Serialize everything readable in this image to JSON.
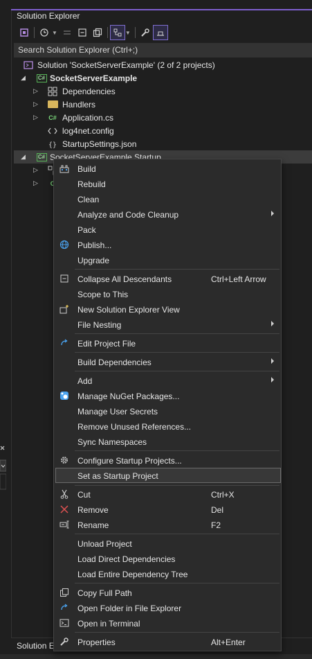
{
  "panel": {
    "title": "Solution Explorer"
  },
  "toolbar": {
    "buttons": [
      "vs-solution-icon",
      "history-icon",
      "sync-icon",
      "collapse-icon",
      "pages-icon",
      "view-icon",
      "wrench-icon",
      "preview-icon"
    ]
  },
  "search": {
    "placeholder": "Search Solution Explorer (Ctrl+;)"
  },
  "tree": {
    "solution": "Solution 'SocketServerExample' (2 of 2 projects)",
    "project1": "SocketServerExample",
    "dependencies": "Dependencies",
    "handlers": "Handlers",
    "application": "Application.cs",
    "log4net": "log4net.config",
    "startup_settings": "StartupSettings.json",
    "project2": "SocketServerExample.Startup"
  },
  "bottom_tab": {
    "label": "Solution E"
  },
  "context_menu": {
    "build": "Build",
    "rebuild": "Rebuild",
    "clean": "Clean",
    "analyze": "Analyze and Code Cleanup",
    "pack": "Pack",
    "publish": "Publish...",
    "upgrade": "Upgrade",
    "collapse_all": "Collapse All Descendants",
    "collapse_all_sc": "Ctrl+Left Arrow",
    "scope": "Scope to This",
    "new_view": "New Solution Explorer View",
    "file_nesting": "File Nesting",
    "edit_project": "Edit Project File",
    "build_deps": "Build Dependencies",
    "add": "Add",
    "nuget": "Manage NuGet Packages...",
    "user_secrets": "Manage User Secrets",
    "remove_unused": "Remove Unused References...",
    "sync_ns": "Sync Namespaces",
    "configure_startup": "Configure Startup Projects...",
    "set_startup": "Set as Startup Project",
    "cut": "Cut",
    "cut_sc": "Ctrl+X",
    "remove": "Remove",
    "remove_sc": "Del",
    "rename": "Rename",
    "rename_sc": "F2",
    "unload": "Unload Project",
    "load_direct": "Load Direct Dependencies",
    "load_entire": "Load Entire Dependency Tree",
    "copy_path": "Copy Full Path",
    "open_folder": "Open Folder in File Explorer",
    "open_terminal": "Open in Terminal",
    "properties": "Properties",
    "properties_sc": "Alt+Enter"
  },
  "colors": {
    "accent": "#7f5fd0",
    "background": "#1f1f1f",
    "menu_bg": "#2b2b2b"
  }
}
